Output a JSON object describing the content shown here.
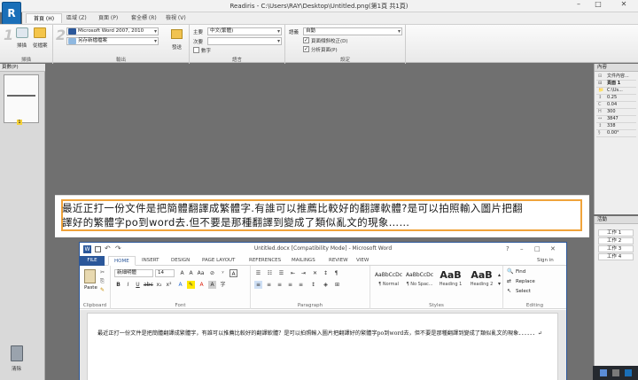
{
  "window": {
    "title": "Readiris - C:\\Users\\RAY\\Desktop\\Untitled.png(第1頁 共1頁)",
    "minimize": "–",
    "maximize": "□",
    "close": "✕"
  },
  "ribbon": {
    "tabs": [
      "首頁 (H)",
      "區域 (Z)",
      "頁面 (P)",
      "套全標 (R)",
      "檢視 (V)"
    ],
    "scan_group": {
      "step": "1",
      "scan_label": "掃描",
      "open_label": "從檔案",
      "group_label": "掃描"
    },
    "output_group": {
      "step": "2",
      "format_value": "Microsoft Word 2007, 2010",
      "save_value": "另存新檔檔案",
      "send_label": "發送",
      "group_label": "輸出"
    },
    "layout_group": {
      "main_label": "主要",
      "main_value": "中文(繁體)",
      "secondary_label": "次要",
      "secondary_value": "",
      "digits_label": "數字",
      "group_label": "語言"
    },
    "settings_group": {
      "mode_label": "語義",
      "mode_value": "自動",
      "opt1": "頁面傾斜校正(D)",
      "opt2": "分析頁面(P)",
      "group_label": "設定"
    }
  },
  "pages_panel": {
    "title": "頁數(P)",
    "page_number": "1",
    "trash_label": "清除"
  },
  "ocr": {
    "line1": "最近正打一份文件是把簡體翻譯成繁體字.有誰可以推薦比較好的翻譯軟體?是可以拍照輸入圖片把翻",
    "line2": "譯好的繁體字po到word去.但不要是那種翻譯到變成了類似亂文的現象……"
  },
  "word": {
    "title": "Untitled.docx [Compatibility Mode] - Microsoft Word",
    "help": "?",
    "signin": "Sign in",
    "tabs": [
      "FILE",
      "HOME",
      "INSERT",
      "DESIGN",
      "PAGE LAYOUT",
      "REFERENCES",
      "MAILINGS",
      "REVIEW",
      "VIEW"
    ],
    "clipboard": {
      "paste": "Paste",
      "label": "Clipboard"
    },
    "font": {
      "name": "新細明體",
      "size": "14",
      "label": "Font"
    },
    "paragraph": {
      "label": "Paragraph"
    },
    "styles": {
      "label": "Styles",
      "items": [
        {
          "sample": "AaBbCcDc",
          "name": "¶ Normal"
        },
        {
          "sample": "AaBbCcDc",
          "name": "¶ No Spac..."
        },
        {
          "sample": "AaB",
          "name": "Heading 1"
        },
        {
          "sample": "AaB",
          "name": "Heading 2"
        }
      ]
    },
    "editing": {
      "find": "Find",
      "replace": "Replace",
      "select": "Select",
      "label": "Editing"
    },
    "body": "最近正打一份文件是把簡體翻譯成繁體字，有誰可以推薦比較好的翻譯軟體？是可以拍照輸入圖片把翻譯好的繁體字po到word去，但不要是那種翻譯到變成了類似亂文的現象．．．．．．↵"
  },
  "content_panel": {
    "title": "內容",
    "root": "文件內容...",
    "page": "頁面 1",
    "rows": [
      {
        "k": "📁",
        "v": "C:\\Us..."
      },
      {
        "k": "↕",
        "v": "0.25"
      },
      {
        "k": "C",
        "v": "0.04"
      },
      {
        "k": "H",
        "v": "300"
      },
      {
        "k": "↔",
        "v": "3847"
      },
      {
        "k": "↕",
        "v": "338"
      },
      {
        "k": "§",
        "v": "0.00°"
      }
    ]
  },
  "jobs_panel": {
    "title": "活動",
    "items": [
      "工作 1",
      "工作 2",
      "工作 3",
      "工作 4"
    ]
  },
  "colors": {
    "accent": "#1a6fb8",
    "ocr_zone": "#f0a33a",
    "word_blue": "#2b579a"
  }
}
